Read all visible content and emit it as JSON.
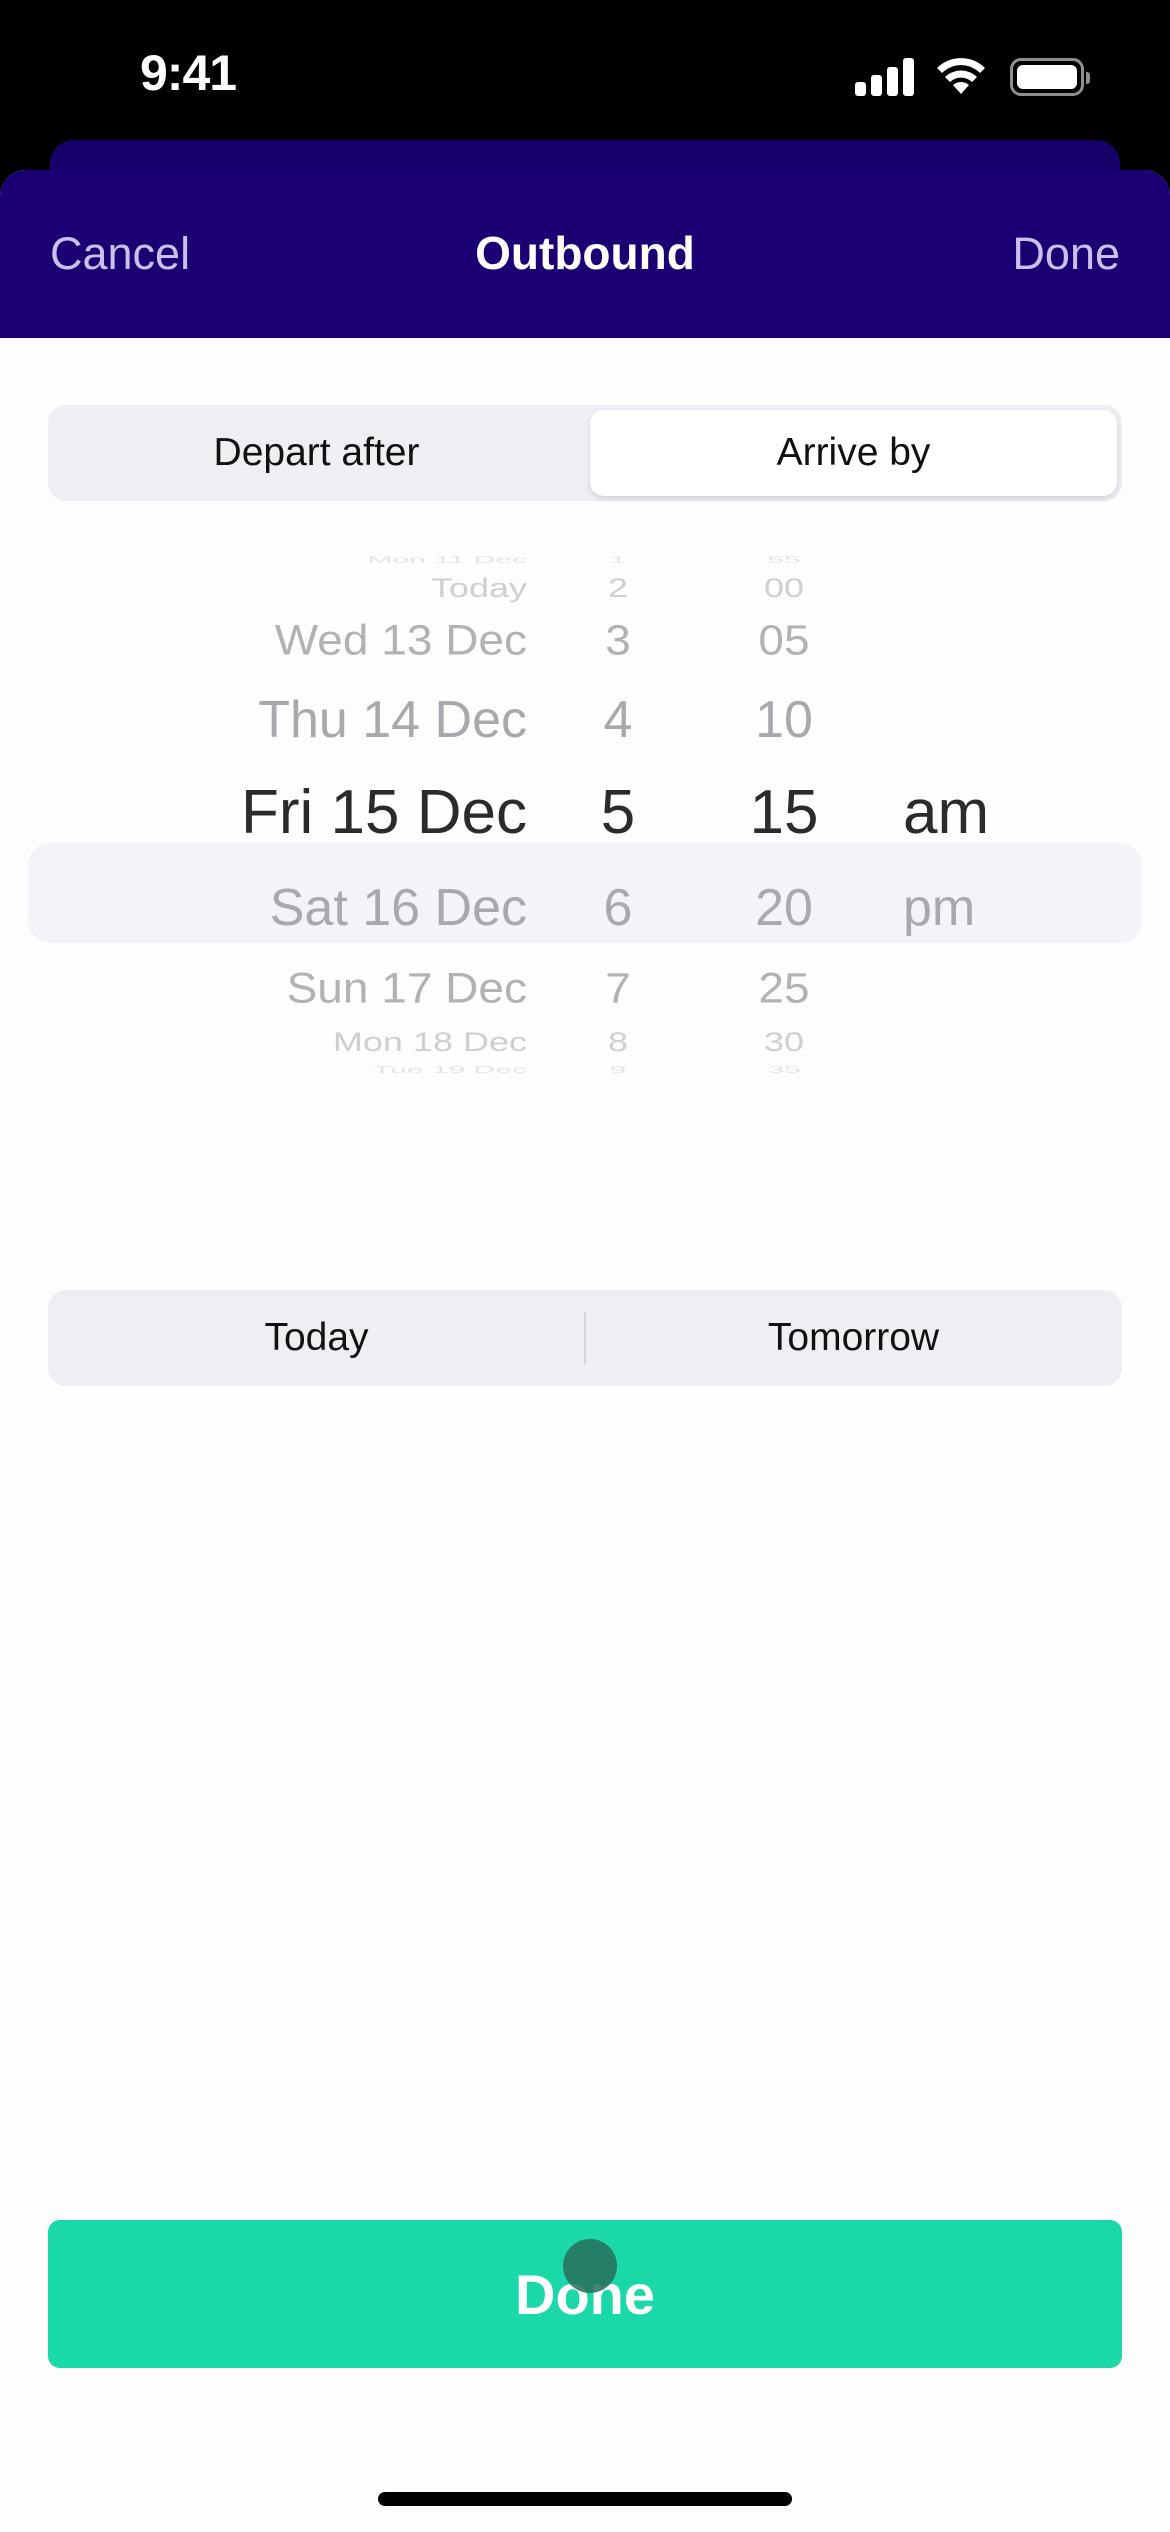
{
  "status_bar": {
    "time": "9:41",
    "icons": [
      "cellular-signal-icon",
      "wifi-icon",
      "battery-icon"
    ]
  },
  "nav": {
    "cancel_label": "Cancel",
    "title": "Outbound",
    "done_label": "Done"
  },
  "mode_segment": {
    "options": [
      {
        "label": "Depart after",
        "selected": false
      },
      {
        "label": "Arrive by",
        "selected": true
      }
    ]
  },
  "picker": {
    "columns": {
      "date": [
        "Mon 11 Dec",
        "Today",
        "Wed 13 Dec",
        "Thu 14 Dec",
        "Fri 15 Dec",
        "Sat 16 Dec",
        "Sun 17 Dec",
        "Mon 18 Dec",
        "Tue 19 Dec"
      ],
      "hour": [
        "1",
        "2",
        "3",
        "4",
        "5",
        "6",
        "7",
        "8",
        "9"
      ],
      "minute": [
        "55",
        "00",
        "05",
        "10",
        "15",
        "20",
        "25",
        "30",
        "35"
      ],
      "ampm": [
        "",
        "",
        "",
        "",
        "am",
        "pm",
        "",
        "",
        ""
      ]
    },
    "selected": {
      "date": "Fri 15 Dec",
      "hour": "5",
      "minute": "15",
      "ampm": "am"
    }
  },
  "quick_day_segment": {
    "options": [
      {
        "label": "Today"
      },
      {
        "label": "Tomorrow"
      }
    ]
  },
  "done_button": {
    "label": "Done",
    "color": "#1ad8a8"
  },
  "colors": {
    "nav_background": "#1a0072",
    "nav_action_text": "#c9c0ec",
    "segment_background": "#efeef3"
  }
}
